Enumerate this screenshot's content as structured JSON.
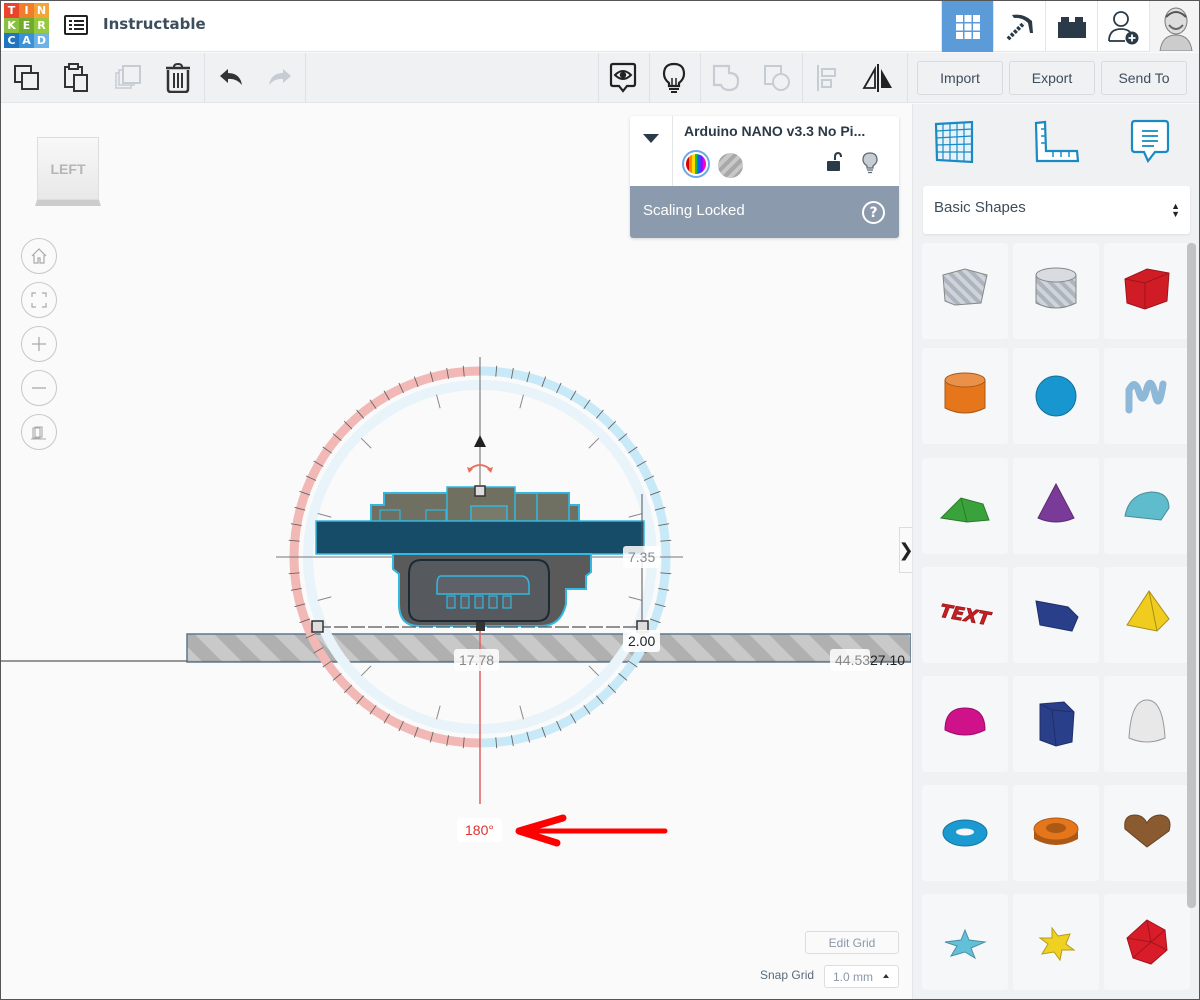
{
  "header": {
    "logo_letters": [
      "T",
      "I",
      "N",
      "K",
      "E",
      "R",
      "C",
      "A",
      "D"
    ],
    "logo_colors": [
      "#e8452c",
      "#f07d2a",
      "#f4a53a",
      "#8cbf3f",
      "#6eab2f",
      "#97c93c",
      "#1f75bf",
      "#3c92d6",
      "#6db3e6"
    ],
    "project_title": "Instructable",
    "right_buttons": [
      {
        "name": "3d-design-view",
        "icon": "grid-icon",
        "active": true
      },
      {
        "name": "codeblocks",
        "icon": "pickaxe-icon",
        "active": false
      },
      {
        "name": "bricks",
        "icon": "brick-icon",
        "active": false
      },
      {
        "name": "invite-user",
        "icon": "add-user-icon",
        "active": false
      }
    ],
    "accent_color": "#5a9bd8"
  },
  "toolbar": {
    "left_actions": [
      {
        "name": "copy",
        "icon": "copy-icon",
        "enabled": true
      },
      {
        "name": "paste",
        "icon": "paste-icon",
        "enabled": true
      },
      {
        "name": "duplicate",
        "icon": "duplicate-icon",
        "enabled": false
      },
      {
        "name": "delete",
        "icon": "trash-icon",
        "enabled": true
      },
      {
        "name": "undo",
        "icon": "undo-icon",
        "enabled": true
      },
      {
        "name": "redo",
        "icon": "redo-icon",
        "enabled": false
      }
    ],
    "right_actions": [
      {
        "name": "notes",
        "icon": "eye-comment-icon",
        "enabled": true
      },
      {
        "name": "show-all",
        "icon": "lightbulb-icon",
        "enabled": true
      },
      {
        "name": "group",
        "icon": "group-icon",
        "enabled": false
      },
      {
        "name": "ungroup",
        "icon": "ungroup-icon",
        "enabled": false
      },
      {
        "name": "align",
        "icon": "align-icon",
        "enabled": false
      },
      {
        "name": "mirror",
        "icon": "mirror-icon",
        "enabled": true
      }
    ],
    "import_label": "Import",
    "export_label": "Export",
    "send_to_label": "Send To"
  },
  "workplane": {
    "viewcube_label": "LEFT",
    "nav_buttons": [
      "home-icon",
      "fit-view-icon",
      "zoom-in-icon",
      "zoom-out-icon",
      "perspective-icon"
    ],
    "dimensions": {
      "height": "7.35",
      "elevation": "2.00",
      "width": "17.78",
      "position_x": "44.53",
      "position_y": "27.10"
    },
    "rotation_angle": "180°",
    "edit_grid_label": "Edit Grid",
    "snap_grid_label": "Snap Grid",
    "snap_grid_value": "1.0 mm"
  },
  "inspector": {
    "object_name": "Arduino NANO v3.3 No Pi...",
    "solid_label": "multicolor",
    "hole_label": "hole",
    "status_text": "Scaling Locked",
    "status_bg": "#8b9aac"
  },
  "right_panel": {
    "tabs": [
      {
        "name": "workplane",
        "icon": "workplane-grid-icon"
      },
      {
        "name": "ruler",
        "icon": "ruler-icon"
      },
      {
        "name": "notes",
        "icon": "note-icon"
      }
    ],
    "category": "Basic Shapes",
    "shapes": [
      {
        "name": "box-hole",
        "color": "#c5c9d0"
      },
      {
        "name": "cylinder-hole",
        "color": "#c5c9d0"
      },
      {
        "name": "box",
        "color": "#d01c24"
      },
      {
        "name": "cylinder",
        "color": "#e5761c"
      },
      {
        "name": "sphere",
        "color": "#1896cf"
      },
      {
        "name": "scribble",
        "color": "#8db8d8"
      },
      {
        "name": "roof",
        "color": "#3aa23a"
      },
      {
        "name": "cone",
        "color": "#7a3a98"
      },
      {
        "name": "round-roof",
        "color": "#5ebccc"
      },
      {
        "name": "text",
        "color": "#c81e24"
      },
      {
        "name": "wedge",
        "color": "#2a3f8a"
      },
      {
        "name": "pyramid",
        "color": "#f0cc1e"
      },
      {
        "name": "half-sphere",
        "color": "#d0128a"
      },
      {
        "name": "polygon",
        "color": "#2a3f8a"
      },
      {
        "name": "paraboloid",
        "color": "#e8e8e8"
      },
      {
        "name": "torus",
        "color": "#1a9ad0"
      },
      {
        "name": "tube",
        "color": "#e5761c"
      },
      {
        "name": "heart",
        "color": "#8a5a30"
      },
      {
        "name": "star",
        "color": "#62c0d8"
      },
      {
        "name": "star-six",
        "color": "#f0d020"
      },
      {
        "name": "icosahedron",
        "color": "#d81c28"
      }
    ]
  }
}
